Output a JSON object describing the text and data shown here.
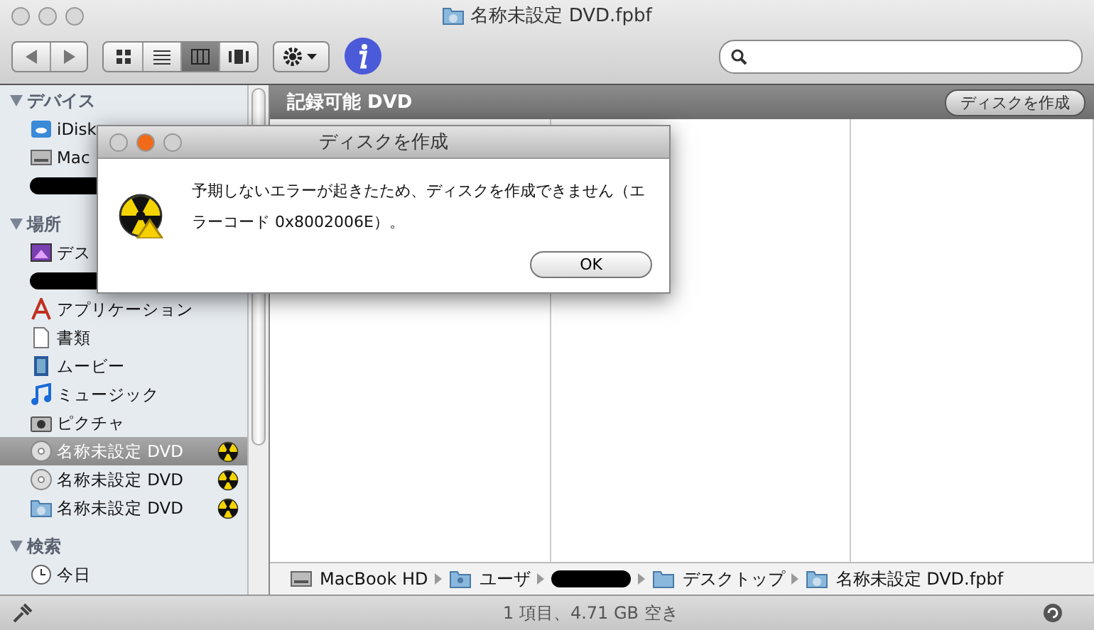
{
  "window": {
    "title": "名称未設定 DVD.fpbf"
  },
  "toolbar": {
    "view_buttons": [
      {
        "kind": "icons",
        "selected": false
      },
      {
        "kind": "list",
        "selected": false
      },
      {
        "kind": "columns",
        "selected": true
      },
      {
        "kind": "coverflow",
        "selected": false
      }
    ]
  },
  "sidebar": {
    "sections": [
      {
        "title": "デバイス",
        "items": [
          {
            "kind": "idisk",
            "label": "iDisk",
            "selected": false,
            "burn": false
          },
          {
            "kind": "drive",
            "label": "Mac",
            "selected": false,
            "burn": false
          },
          {
            "kind": "redacted",
            "selected": false,
            "burn": false
          }
        ]
      },
      {
        "title": "場所",
        "items": [
          {
            "kind": "desktop",
            "label": "デス",
            "selected": false,
            "burn": false
          },
          {
            "kind": "redacted",
            "selected": false,
            "burn": false
          },
          {
            "kind": "apps",
            "label": "アプリケーション",
            "selected": false,
            "burn": false
          },
          {
            "kind": "document",
            "label": "書類",
            "selected": false,
            "burn": false
          },
          {
            "kind": "movie",
            "label": "ムービー",
            "selected": false,
            "burn": false
          },
          {
            "kind": "music",
            "label": "ミュージック",
            "selected": false,
            "burn": false
          },
          {
            "kind": "camera",
            "label": "ピクチャ",
            "selected": false,
            "burn": false
          },
          {
            "kind": "disc",
            "label": "名称未設定 DVD",
            "selected": true,
            "burn": true
          },
          {
            "kind": "disc",
            "label": "名称未設定 DVD",
            "selected": false,
            "burn": true
          },
          {
            "kind": "burnfolder",
            "label": "名称未設定 DVD",
            "selected": false,
            "burn": true
          }
        ]
      },
      {
        "title": "検索",
        "items": [
          {
            "kind": "clock",
            "label": "今日",
            "selected": false,
            "burn": false
          }
        ]
      }
    ]
  },
  "content": {
    "header": "記録可能 DVD",
    "button": "ディスクを作成"
  },
  "path_bar": [
    {
      "kind": "drive",
      "label": "MacBook HD"
    },
    {
      "kind": "userfolder",
      "label": "ユーザ"
    },
    {
      "kind": "redacted"
    },
    {
      "kind": "folder",
      "label": "デスクトップ"
    },
    {
      "kind": "burnfolder",
      "label": "名称未設定 DVD.fpbf"
    }
  ],
  "status_bar": "1 項目、4.71 GB 空き",
  "dialog": {
    "title": "ディスクを作成",
    "message": "予期しないエラーが起きたため、ディスクを作成できません（エラーコード 0x8002006E）。",
    "button": "OK"
  }
}
